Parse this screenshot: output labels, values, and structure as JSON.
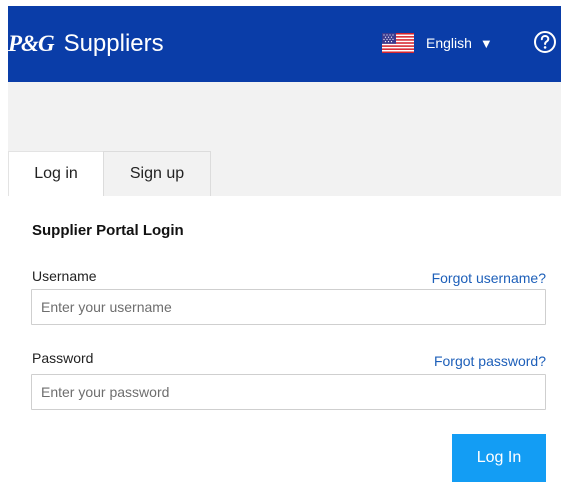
{
  "header": {
    "logo_text": "P&G",
    "title": "Suppliers",
    "language": {
      "label": "English",
      "caret": "▼",
      "flag_icon": "us-flag-icon"
    },
    "help_icon": "question-circle-icon",
    "background_color": "#0a3da8"
  },
  "tabs": [
    {
      "label": "Log in",
      "active": true
    },
    {
      "label": "Sign up",
      "active": false
    }
  ],
  "form": {
    "title": "Supplier Portal Login",
    "username": {
      "label": "Username",
      "forgot_link": "Forgot username?",
      "placeholder": "Enter your username",
      "value": ""
    },
    "password": {
      "label": "Password",
      "forgot_link": "Forgot password?",
      "placeholder": "Enter your password",
      "value": ""
    },
    "submit_label": "Log In",
    "submit_color": "#139df4"
  }
}
